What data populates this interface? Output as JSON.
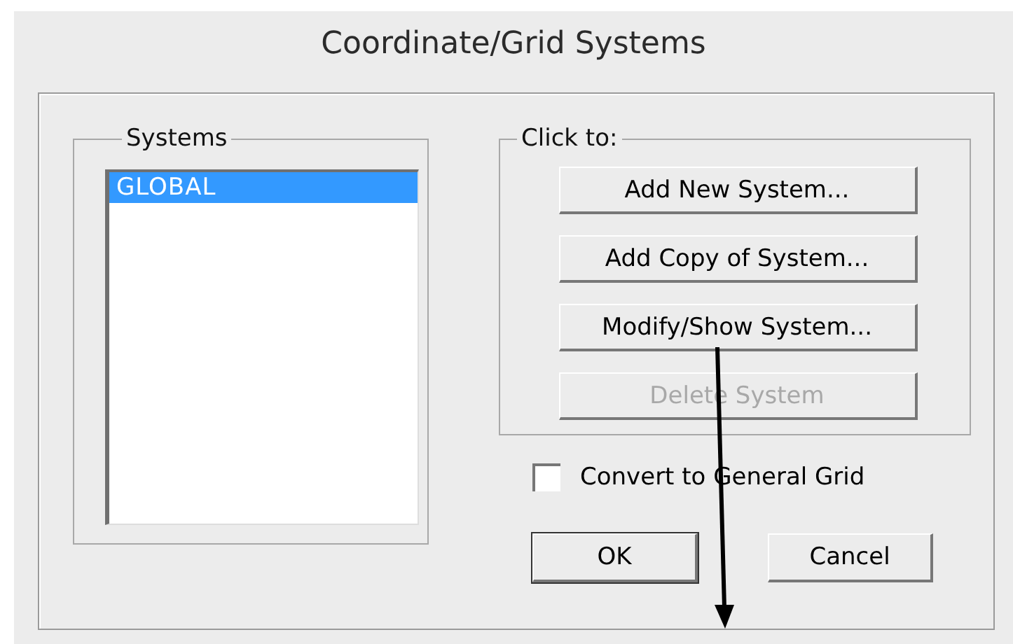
{
  "window": {
    "title": "Coordinate/Grid Systems"
  },
  "systems": {
    "label": "Systems",
    "items": [
      {
        "label": "GLOBAL",
        "selected": true
      }
    ]
  },
  "actions": {
    "label": "Click to:",
    "buttons": [
      {
        "label": "Add New System...",
        "disabled": false
      },
      {
        "label": "Add Copy of System...",
        "disabled": false
      },
      {
        "label": "Modify/Show System...",
        "disabled": false
      },
      {
        "label": "Delete System",
        "disabled": true
      }
    ]
  },
  "convert": {
    "label": "Convert to General Grid",
    "checked": false
  },
  "buttons": [
    "OK",
    "Cancel"
  ],
  "annotation": {
    "kind": "arrow"
  }
}
